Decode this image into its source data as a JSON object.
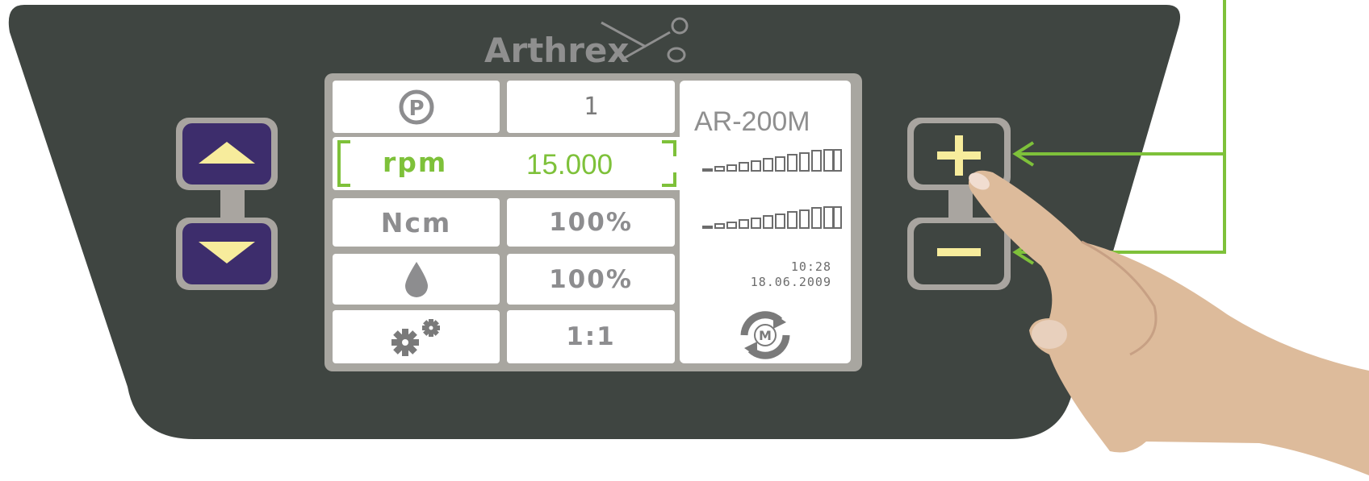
{
  "brand": {
    "logo_text": "Arthrex"
  },
  "screen": {
    "rows": [
      {
        "label_icon": "program-p-icon",
        "value": "1"
      },
      {
        "label": "rpm",
        "value": "15.000",
        "selected": true
      },
      {
        "label": "Ncm",
        "value": "100%"
      },
      {
        "label_icon": "irrigation-drop-icon",
        "value": "100%"
      },
      {
        "label_icon": "gears-ratio-icon",
        "value": "1:1"
      }
    ],
    "model": "AR-200M",
    "time": "10:28",
    "date": "18.06.2009",
    "mode_icon": "motor-cycle-m-icon",
    "level_bars_icon": "level-bars-icon"
  },
  "buttons": {
    "left_up": "up-arrow-icon",
    "left_down": "down-arrow-icon",
    "right_plus": "plus-icon",
    "right_minus": "minus-icon"
  },
  "colors": {
    "panel": "#3f4541",
    "button_purple": "#3d2d6c",
    "button_frame": "#a9a5a0",
    "arrow_yellow": "#f7ec9c",
    "accent_green": "#7ec13a",
    "screen_bezel": "#a8a6a0"
  }
}
